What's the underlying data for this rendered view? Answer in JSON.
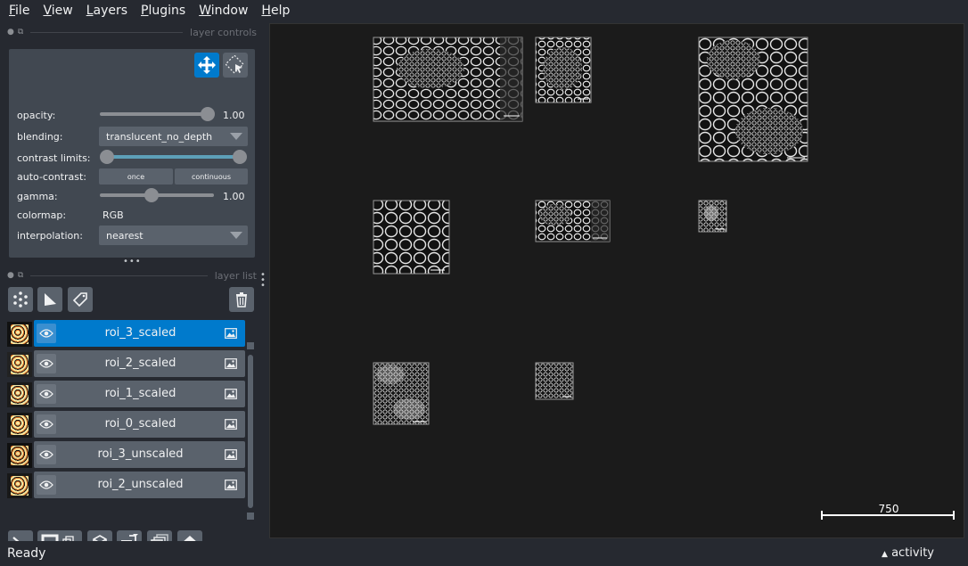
{
  "menu": [
    {
      "label": "File",
      "mnemonic": "F",
      "rest": "ile"
    },
    {
      "label": "View",
      "mnemonic": "V",
      "rest": "iew"
    },
    {
      "label": "Layers",
      "mnemonic": "L",
      "rest": "ayers"
    },
    {
      "label": "Plugins",
      "mnemonic": "P",
      "rest": "lugins"
    },
    {
      "label": "Window",
      "mnemonic": "W",
      "rest": "indow"
    },
    {
      "label": "Help",
      "mnemonic": "H",
      "rest": "elp"
    }
  ],
  "layer_controls": {
    "title": "layer controls",
    "opacity_label": "opacity:",
    "opacity_value": "1.00",
    "blending_label": "blending:",
    "blending_value": "translucent_no_depth",
    "contrast_label": "contrast limits:",
    "auto_contrast_label": "auto-contrast:",
    "once_label": "once",
    "continuous_label": "continuous",
    "gamma_label": "gamma:",
    "gamma_value": "1.00",
    "colormap_label": "colormap:",
    "colormap_value": "RGB",
    "interpolation_label": "interpolation:",
    "interpolation_value": "nearest"
  },
  "layer_list": {
    "title": "layer list",
    "layers": [
      {
        "name": "roi_3_scaled",
        "selected": true
      },
      {
        "name": "roi_2_scaled",
        "selected": false
      },
      {
        "name": "roi_1_scaled",
        "selected": false
      },
      {
        "name": "roi_0_scaled",
        "selected": false
      },
      {
        "name": "roi_3_unscaled",
        "selected": false
      },
      {
        "name": "roi_2_unscaled",
        "selected": false
      }
    ]
  },
  "canvas": {
    "scale_bar_label": "750"
  },
  "status": {
    "text": "Ready",
    "activity_label": "activity"
  },
  "colors": {
    "background": "#262930",
    "panel": "#414851",
    "button": "#5a626c",
    "accent": "#007acc",
    "canvas": "#1b1b1b"
  }
}
